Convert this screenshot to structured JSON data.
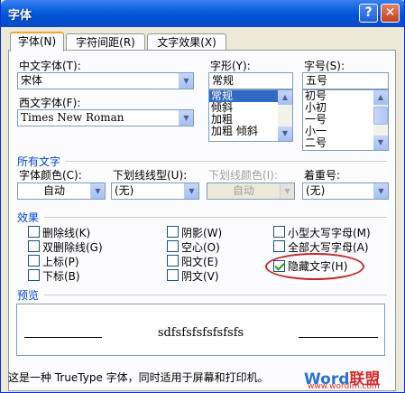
{
  "window": {
    "title": "字体"
  },
  "titlebar_buttons": {
    "help": "?",
    "close": "✕"
  },
  "tabs": [
    {
      "label": "字体(N)"
    },
    {
      "label": "字符间距(R)"
    },
    {
      "label": "文字效果(X)"
    }
  ],
  "font": {
    "chinese_label": "中文字体(T):",
    "chinese_value": "宋体",
    "western_label": "西文字体(F):",
    "western_value": "Times New Roman",
    "style_label": "字形(Y):",
    "style_value": "常规",
    "style_items": [
      "常规",
      "倾斜",
      "加粗",
      "加粗 倾斜"
    ],
    "size_label": "字号(S):",
    "size_value": "五号",
    "size_items": [
      "初号",
      "小初",
      "一号",
      "小一",
      "二号"
    ]
  },
  "all_text": {
    "section": "所有文字",
    "color_label": "字体颜色(C):",
    "color_value": "自动",
    "underline_label": "下划线线型(U):",
    "underline_value": "(无)",
    "underline_color_label": "下划线颜色(I):",
    "underline_color_value": "自动",
    "emphasis_label": "着重号:",
    "emphasis_value": "(无)"
  },
  "effects": {
    "section": "效果",
    "items": [
      {
        "label": "删除线(K)",
        "checked": false
      },
      {
        "label": "双删除线(G)",
        "checked": false
      },
      {
        "label": "上标(P)",
        "checked": false
      },
      {
        "label": "下标(B)",
        "checked": false
      },
      {
        "label": "阴影(W)",
        "checked": false
      },
      {
        "label": "空心(O)",
        "checked": false
      },
      {
        "label": "阳文(E)",
        "checked": false
      },
      {
        "label": "阴文(V)",
        "checked": false
      },
      {
        "label": "小型大写字母(M)",
        "checked": false
      },
      {
        "label": "全部大写字母(A)",
        "checked": false
      },
      {
        "label": "隐藏文字(H)",
        "checked": true
      }
    ]
  },
  "preview": {
    "section": "预览",
    "sample": "sdfsfsfsfsfsfsfs"
  },
  "footer": "这是一种 TrueType 字体，同时适用于屏幕和打印机。",
  "watermark": {
    "brand_a": "Word",
    "brand_b": "联盟",
    "url": "www.wordlm.com"
  },
  "colors": {
    "titlebar": "#0a5fde",
    "section": "#0046d5",
    "highlight": "#c0282a",
    "selection": "#316ac5"
  }
}
